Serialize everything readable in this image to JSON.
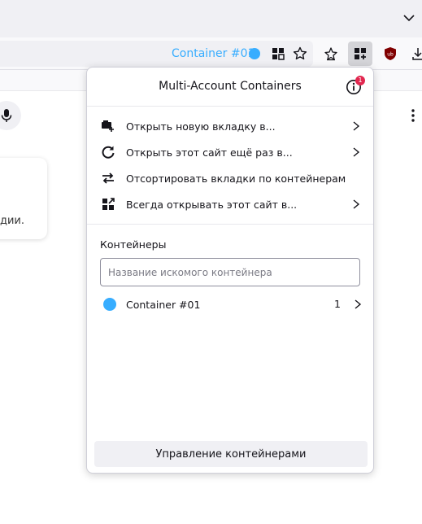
{
  "toolbar": {
    "container_label": "Container #01",
    "container_color": "#37adff"
  },
  "page": {
    "card_text": "дии."
  },
  "panel": {
    "title": "Multi-Account Containers",
    "info_badge": "1",
    "menu": [
      {
        "label": "Открыть новую вкладку в...",
        "icon": "new-tab-container-icon",
        "has_submenu": true
      },
      {
        "label": "Открыть этот сайт ещё раз в...",
        "icon": "reopen-icon",
        "has_submenu": true
      },
      {
        "label": "Отсортировать вкладки по контейнерам",
        "icon": "sort-icon",
        "has_submenu": false
      },
      {
        "label": "Всегда открывать этот сайт в...",
        "icon": "always-open-icon",
        "has_submenu": true
      }
    ],
    "section_title": "Контейнеры",
    "search_placeholder": "Название искомого контейнера",
    "containers": [
      {
        "name": "Container #01",
        "count": "1",
        "color": "#37adff"
      }
    ],
    "manage_label": "Управление контейнерами"
  }
}
